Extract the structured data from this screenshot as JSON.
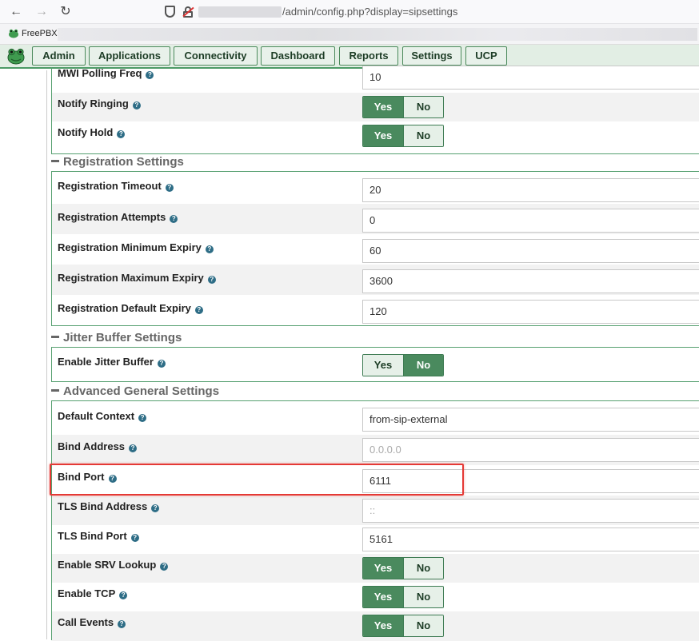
{
  "browser": {
    "url": "/admin/config.php?display=sipsettings",
    "bookmark": "FreePBX"
  },
  "nav": {
    "tabs": [
      "Admin",
      "Applications",
      "Connectivity",
      "Dashboard",
      "Reports",
      "Settings",
      "UCP"
    ]
  },
  "mwi": {
    "polling_label": "MWI Polling Freq",
    "polling_value": "10",
    "notify_ringing_label": "Notify Ringing",
    "notify_hold_label": "Notify Hold"
  },
  "registration": {
    "title": "Registration Settings",
    "timeout_label": "Registration Timeout",
    "timeout_value": "20",
    "attempts_label": "Registration Attempts",
    "attempts_value": "0",
    "min_expiry_label": "Registration Minimum Expiry",
    "min_expiry_value": "60",
    "max_expiry_label": "Registration Maximum Expiry",
    "max_expiry_value": "3600",
    "default_expiry_label": "Registration Default Expiry",
    "default_expiry_value": "120"
  },
  "jitter": {
    "title": "Jitter Buffer Settings",
    "enable_label": "Enable Jitter Buffer"
  },
  "advanced": {
    "title": "Advanced General Settings",
    "default_context_label": "Default Context",
    "default_context_value": "from-sip-external",
    "bind_address_label": "Bind Address",
    "bind_address_placeholder": "0.0.0.0",
    "bind_port_label": "Bind Port",
    "bind_port_value": "6111",
    "tls_bind_address_label": "TLS Bind Address",
    "tls_bind_address_placeholder": "::",
    "tls_bind_port_label": "TLS Bind Port",
    "tls_bind_port_value": "5161",
    "srv_lookup_label": "Enable SRV Lookup",
    "tcp_label": "Enable TCP",
    "call_events_label": "Call Events"
  },
  "toggle": {
    "yes": "Yes",
    "no": "No"
  },
  "help_glyph": "?",
  "colors": {
    "accent": "#4a8a5e",
    "highlight": "#e53935"
  }
}
